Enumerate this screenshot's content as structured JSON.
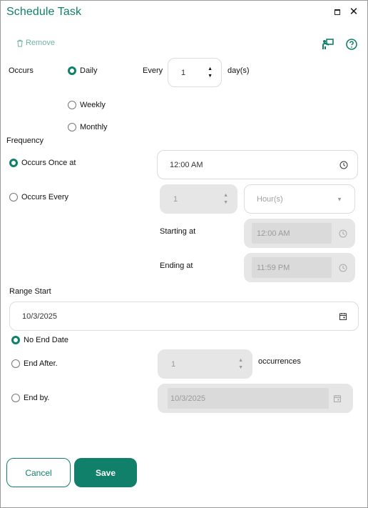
{
  "dialog": {
    "title": "Schedule Task",
    "maximize_icon": "maximize-icon",
    "close_label": "✕"
  },
  "toolbar": {
    "remove_label": "Remove",
    "remove_icon": "trash-icon",
    "presenter_icon": "presenter-icon",
    "help_icon": "help-circle-icon"
  },
  "occurs": {
    "label": "Occurs",
    "options": [
      {
        "label": "Daily",
        "checked": true
      },
      {
        "label": "Weekly",
        "checked": false
      },
      {
        "label": "Monthly",
        "checked": false
      }
    ],
    "every_label": "Every",
    "every_value": "1",
    "unit_label": "day(s)"
  },
  "frequency": {
    "label": "Frequency",
    "once_label": "Occurs Once at",
    "once_checked": true,
    "once_time": "12:00 AM",
    "every_label": "Occurs Every",
    "every_checked": false,
    "every_value": "1",
    "every_unit": "Hour(s)",
    "starting_label": "Starting at",
    "starting_value": "12:00 AM",
    "ending_label": "Ending at",
    "ending_value": "11:59 PM"
  },
  "range": {
    "label": "Range Start",
    "start_date": "10/3/2025",
    "no_end_label": "No End Date",
    "no_end_checked": true,
    "end_after_label": "End After.",
    "end_after_value": "1",
    "occurrences_label": "occurrences",
    "end_by_label": "End by.",
    "end_by_value": "10/3/2025"
  },
  "buttons": {
    "cancel_label": "Cancel",
    "save_label": "Save"
  },
  "colors": {
    "accent": "#11806a",
    "disabled_bg": "#e6e6e6"
  }
}
